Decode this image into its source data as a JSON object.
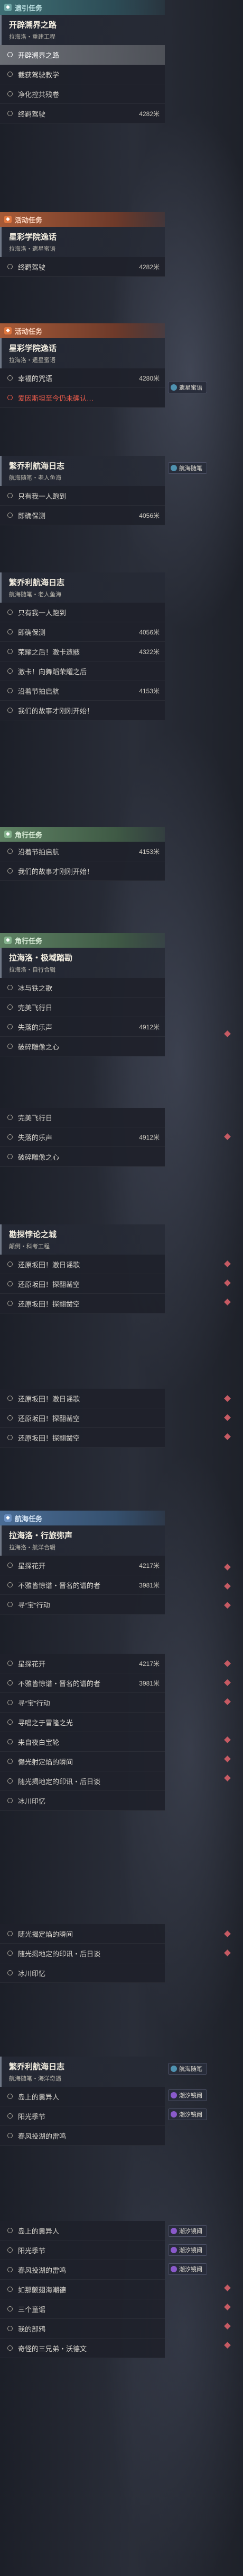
{
  "s1": {
    "cat": "遗引任务",
    "qt": "开辟溯界之路",
    "qs": "拉海洛・重建工程",
    "rows": [
      {
        "l": "开辟溯界之路",
        "d": "",
        "sel": true
      },
      {
        "l": "截获驾驶教学",
        "d": ""
      },
      {
        "l": "净化控共残卷",
        "d": ""
      },
      {
        "l": "终羁驾驶",
        "d": "4282米"
      }
    ]
  },
  "s2": {
    "cat": "活动任务",
    "qt": "星彩学院逸话",
    "qs": "拉海洛・遗星蜜语",
    "rows": [
      {
        "l": "终羁驾驶",
        "d": "4282米"
      }
    ]
  },
  "s3": {
    "cat": "活动任务",
    "qt": "星彩学院逸话",
    "qs": "拉海洛・遗星蜜语",
    "rows": [
      {
        "l": "幸福的咒语",
        "d": "4280米"
      },
      {
        "l": "爱因斯坦至今仍未确认…",
        "d": "",
        "red": true
      }
    ],
    "badge": "遗星蜜语"
  },
  "s4": {
    "qt": "繁乔利航海日志",
    "qs": "航海随笔・老人鱼海",
    "rows": [
      {
        "l": "只有我一人跑到",
        "d": ""
      },
      {
        "l": "即确保测",
        "d": "4056米"
      }
    ],
    "badge": "航海随笔"
  },
  "s5": {
    "qt": "繁乔利航海日志",
    "qs": "航海随笔・老人鱼海",
    "rows": [
      {
        "l": "只有我一人跑到",
        "d": ""
      },
      {
        "l": "即确保测",
        "d": "4056米"
      },
      {
        "l": "荣耀之后！激卡遗骸",
        "d": "4322米"
      },
      {
        "l": "激卡！向舞蹈荣耀之后",
        "d": ""
      },
      {
        "l": "沿着节拍启航",
        "d": "4153米"
      },
      {
        "l": "我们的故事才刚刚开始！",
        "d": ""
      }
    ]
  },
  "s6": {
    "cat": "角行任务",
    "rows": [
      {
        "l": "沿着节拍启航",
        "d": "4153米"
      },
      {
        "l": "我们的故事才刚刚开始！",
        "d": ""
      }
    ]
  },
  "s7": {
    "cat": "角行任务",
    "qt": "拉海洛・极域踏勘",
    "qs": "拉海洛・自行合辑",
    "rows": [
      {
        "l": "冰与铁之歌",
        "d": ""
      },
      {
        "l": "完美飞行日",
        "d": ""
      },
      {
        "l": "失落的乐声",
        "d": "4912米"
      },
      {
        "l": "破碎雕像之心",
        "d": ""
      }
    ]
  },
  "s8": {
    "rows": [
      {
        "l": "完美飞行日",
        "d": ""
      },
      {
        "l": "失落的乐声",
        "d": "4912米"
      },
      {
        "l": "破碎雕像之心",
        "d": ""
      }
    ]
  },
  "s9": {
    "qt": "勘探悖论之城",
    "qs": "颠倒・科考工程",
    "rows": [
      {
        "l": "还原坂田！激日谣歌",
        "d": ""
      },
      {
        "l": "还原坂田！探翻凿空",
        "d": ""
      },
      {
        "l": "还原坂田！探翻凿空",
        "d": ""
      }
    ]
  },
  "s10": {
    "rows": [
      {
        "l": "还原坂田！激日谣歌",
        "d": ""
      },
      {
        "l": "还原坂田！探翻凿空",
        "d": ""
      },
      {
        "l": "还原坂田！探翻凿空",
        "d": ""
      }
    ]
  },
  "s11": {
    "cat": "航海任务",
    "qt": "拉海洛・行旅弥声",
    "qs": "拉海洛・航洋合辑",
    "rows": [
      {
        "l": "星探花开",
        "d": "4217米"
      },
      {
        "l": "不雅皆惊谱・晋名的谱的者",
        "d": "3981米"
      },
      {
        "l": "寻“宝”行动",
        "d": ""
      }
    ]
  },
  "s12": {
    "rows": [
      {
        "l": "星探花开",
        "d": "4217米"
      },
      {
        "l": "不雅皆惊谱・晋名的谱的者",
        "d": "3981米"
      },
      {
        "l": "寻“宝”行动",
        "d": ""
      },
      {
        "l": "寻唱之于冒隆之光",
        "d": ""
      },
      {
        "l": "来自夜白宝轮",
        "d": ""
      },
      {
        "l": "懒光射定焰的瞬间",
        "d": ""
      },
      {
        "l": "随光揭地定的印讯・后日谈",
        "d": ""
      },
      {
        "l": "冰川印忆",
        "d": ""
      }
    ]
  },
  "s13": {
    "rows": [
      {
        "l": "随光揭定焰的瞬间",
        "d": ""
      },
      {
        "l": "随光揭地定的印讯・后日谈",
        "d": ""
      },
      {
        "l": "冰川印忆",
        "d": ""
      }
    ]
  },
  "s14": {
    "qt": "繁乔利航海日志",
    "qs": "航海随笔・海洋奇遇",
    "rows": [
      {
        "l": "岛上的囊异人",
        "d": ""
      },
      {
        "l": "阳光季节",
        "d": ""
      },
      {
        "l": "春风投湖的雷鸣",
        "d": ""
      }
    ],
    "badges": [
      "航海随笔",
      "潮汐镜阈",
      "潮汐镜阈"
    ]
  },
  "s15": {
    "rows": [
      {
        "l": "岛上的囊异人",
        "d": ""
      },
      {
        "l": "阳光季节",
        "d": ""
      },
      {
        "l": "春风投湖的雷鸣",
        "d": ""
      },
      {
        "l": "如那颤翅海潮德",
        "d": ""
      },
      {
        "l": "三个童谣",
        "d": ""
      },
      {
        "l": "我的部鸦",
        "d": ""
      },
      {
        "l": "奇怪的三兄弟・沃德文",
        "d": ""
      }
    ],
    "badges": [
      "潮汐镜阈",
      "潮汐镜阈",
      "潮汐镜阈"
    ]
  }
}
